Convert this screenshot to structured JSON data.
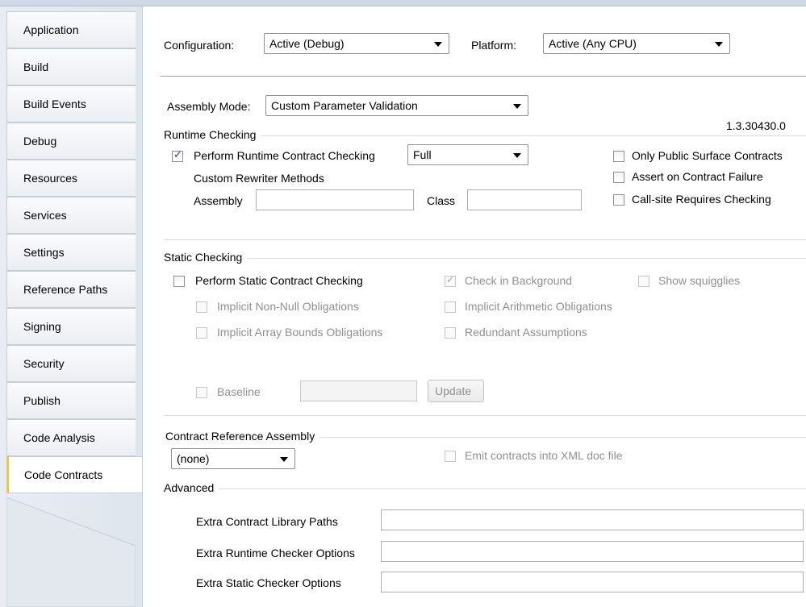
{
  "sidebar": {
    "tabs": [
      {
        "label": "Application"
      },
      {
        "label": "Build"
      },
      {
        "label": "Build Events"
      },
      {
        "label": "Debug"
      },
      {
        "label": "Resources"
      },
      {
        "label": "Services"
      },
      {
        "label": "Settings"
      },
      {
        "label": "Reference Paths"
      },
      {
        "label": "Signing"
      },
      {
        "label": "Security"
      },
      {
        "label": "Publish"
      },
      {
        "label": "Code Analysis"
      },
      {
        "label": "Code Contracts"
      }
    ],
    "active_tab": "Code Contracts"
  },
  "header": {
    "configuration_label": "Configuration:",
    "configuration_value": "Active (Debug)",
    "platform_label": "Platform:",
    "platform_value": "Active (Any CPU)"
  },
  "assembly": {
    "mode_label": "Assembly Mode:",
    "mode_value": "Custom Parameter Validation",
    "version": "1.3.30430.0"
  },
  "runtime": {
    "title": "Runtime Checking",
    "perform_label": "Perform Runtime Contract Checking",
    "perform_checked": true,
    "level_value": "Full",
    "custom_rewriter_label": "Custom Rewriter Methods",
    "assembly_label": "Assembly",
    "assembly_value": "",
    "class_label": "Class",
    "class_value": "",
    "only_public_label": "Only Public Surface Contracts",
    "assert_label": "Assert on Contract Failure",
    "callsite_label": "Call-site Requires Checking"
  },
  "static": {
    "title": "Static Checking",
    "perform_label": "Perform Static Contract Checking",
    "background_label": "Check in Background",
    "background_checked": true,
    "squigglies_label": "Show squigglies",
    "nonnull_label": "Implicit Non-Null Obligations",
    "arith_label": "Implicit Arithmetic Obligations",
    "array_label": "Implicit Array Bounds Obligations",
    "redundant_label": "Redundant Assumptions",
    "baseline_label": "Baseline",
    "baseline_value": "",
    "update_label": "Update"
  },
  "reference": {
    "title": "Contract Reference Assembly",
    "value": "(none)",
    "emit_label": "Emit contracts into XML doc file"
  },
  "advanced": {
    "title": "Advanced",
    "library_label": "Extra Contract Library Paths",
    "library_value": "",
    "runtime_label": "Extra Runtime Checker Options",
    "runtime_value": "",
    "static_label": "Extra Static Checker Options",
    "static_value": ""
  },
  "colors": {
    "active_tab_accent": "#f2c649",
    "check_mark": "#2b3f8f",
    "disabled_text": "#8f8f8f"
  }
}
